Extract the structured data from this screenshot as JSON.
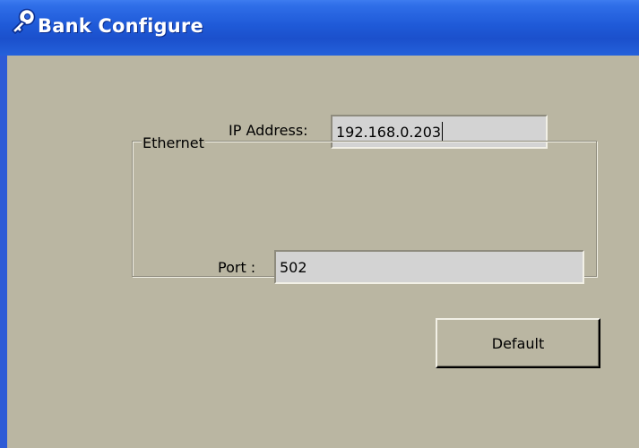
{
  "window": {
    "title": "Bank Configure",
    "icon": "wrench-icon"
  },
  "ip": {
    "label": "IP Address:",
    "value": "192.168.0.203"
  },
  "ethernet": {
    "group_label": "Ethernet",
    "port_label": "Port :",
    "port_value": "502"
  },
  "buttons": {
    "default_label": "Default"
  },
  "colors": {
    "titlebar": "#1f5ad8",
    "client_background": "#bab6a2",
    "field_background": "#d3d3d3"
  }
}
